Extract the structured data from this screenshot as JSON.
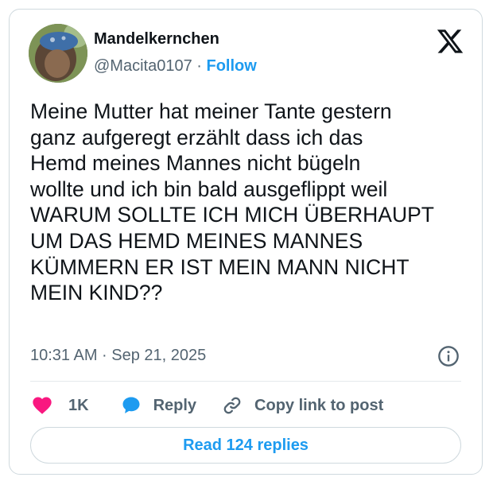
{
  "author": {
    "display_name": "Mandelkernchen",
    "handle": "@Macita0107",
    "separator": "·",
    "follow_label": "Follow"
  },
  "tweet": {
    "text": "Meine Mutter hat meiner Tante gestern\nganz aufgeregt erzählt dass ich das\nHemd meines Mannes nicht bügeln\nwollte und ich bin bald ausgeflippt weil\nWARUM SOLLTE ICH MICH ÜBERHAUPT\nUM DAS HEMD MEINES MANNES\nKÜMMERN ER IST MEIN MANN NICHT\nMEIN KIND??",
    "timestamp": "10:31 AM · Sep 21, 2025"
  },
  "actions": {
    "like_count": "1K",
    "reply_label": "Reply",
    "copy_label": "Copy link to post"
  },
  "read_replies_label": "Read 124 replies",
  "icons": {
    "logo": "x-logo-icon",
    "info": "info-icon",
    "like": "heart-icon",
    "reply": "speech-bubble-icon",
    "copy": "link-icon"
  },
  "colors": {
    "accent": "#1d9bf0",
    "like": "#f91880",
    "secondary_text": "#536471",
    "border": "#cfd9de"
  }
}
